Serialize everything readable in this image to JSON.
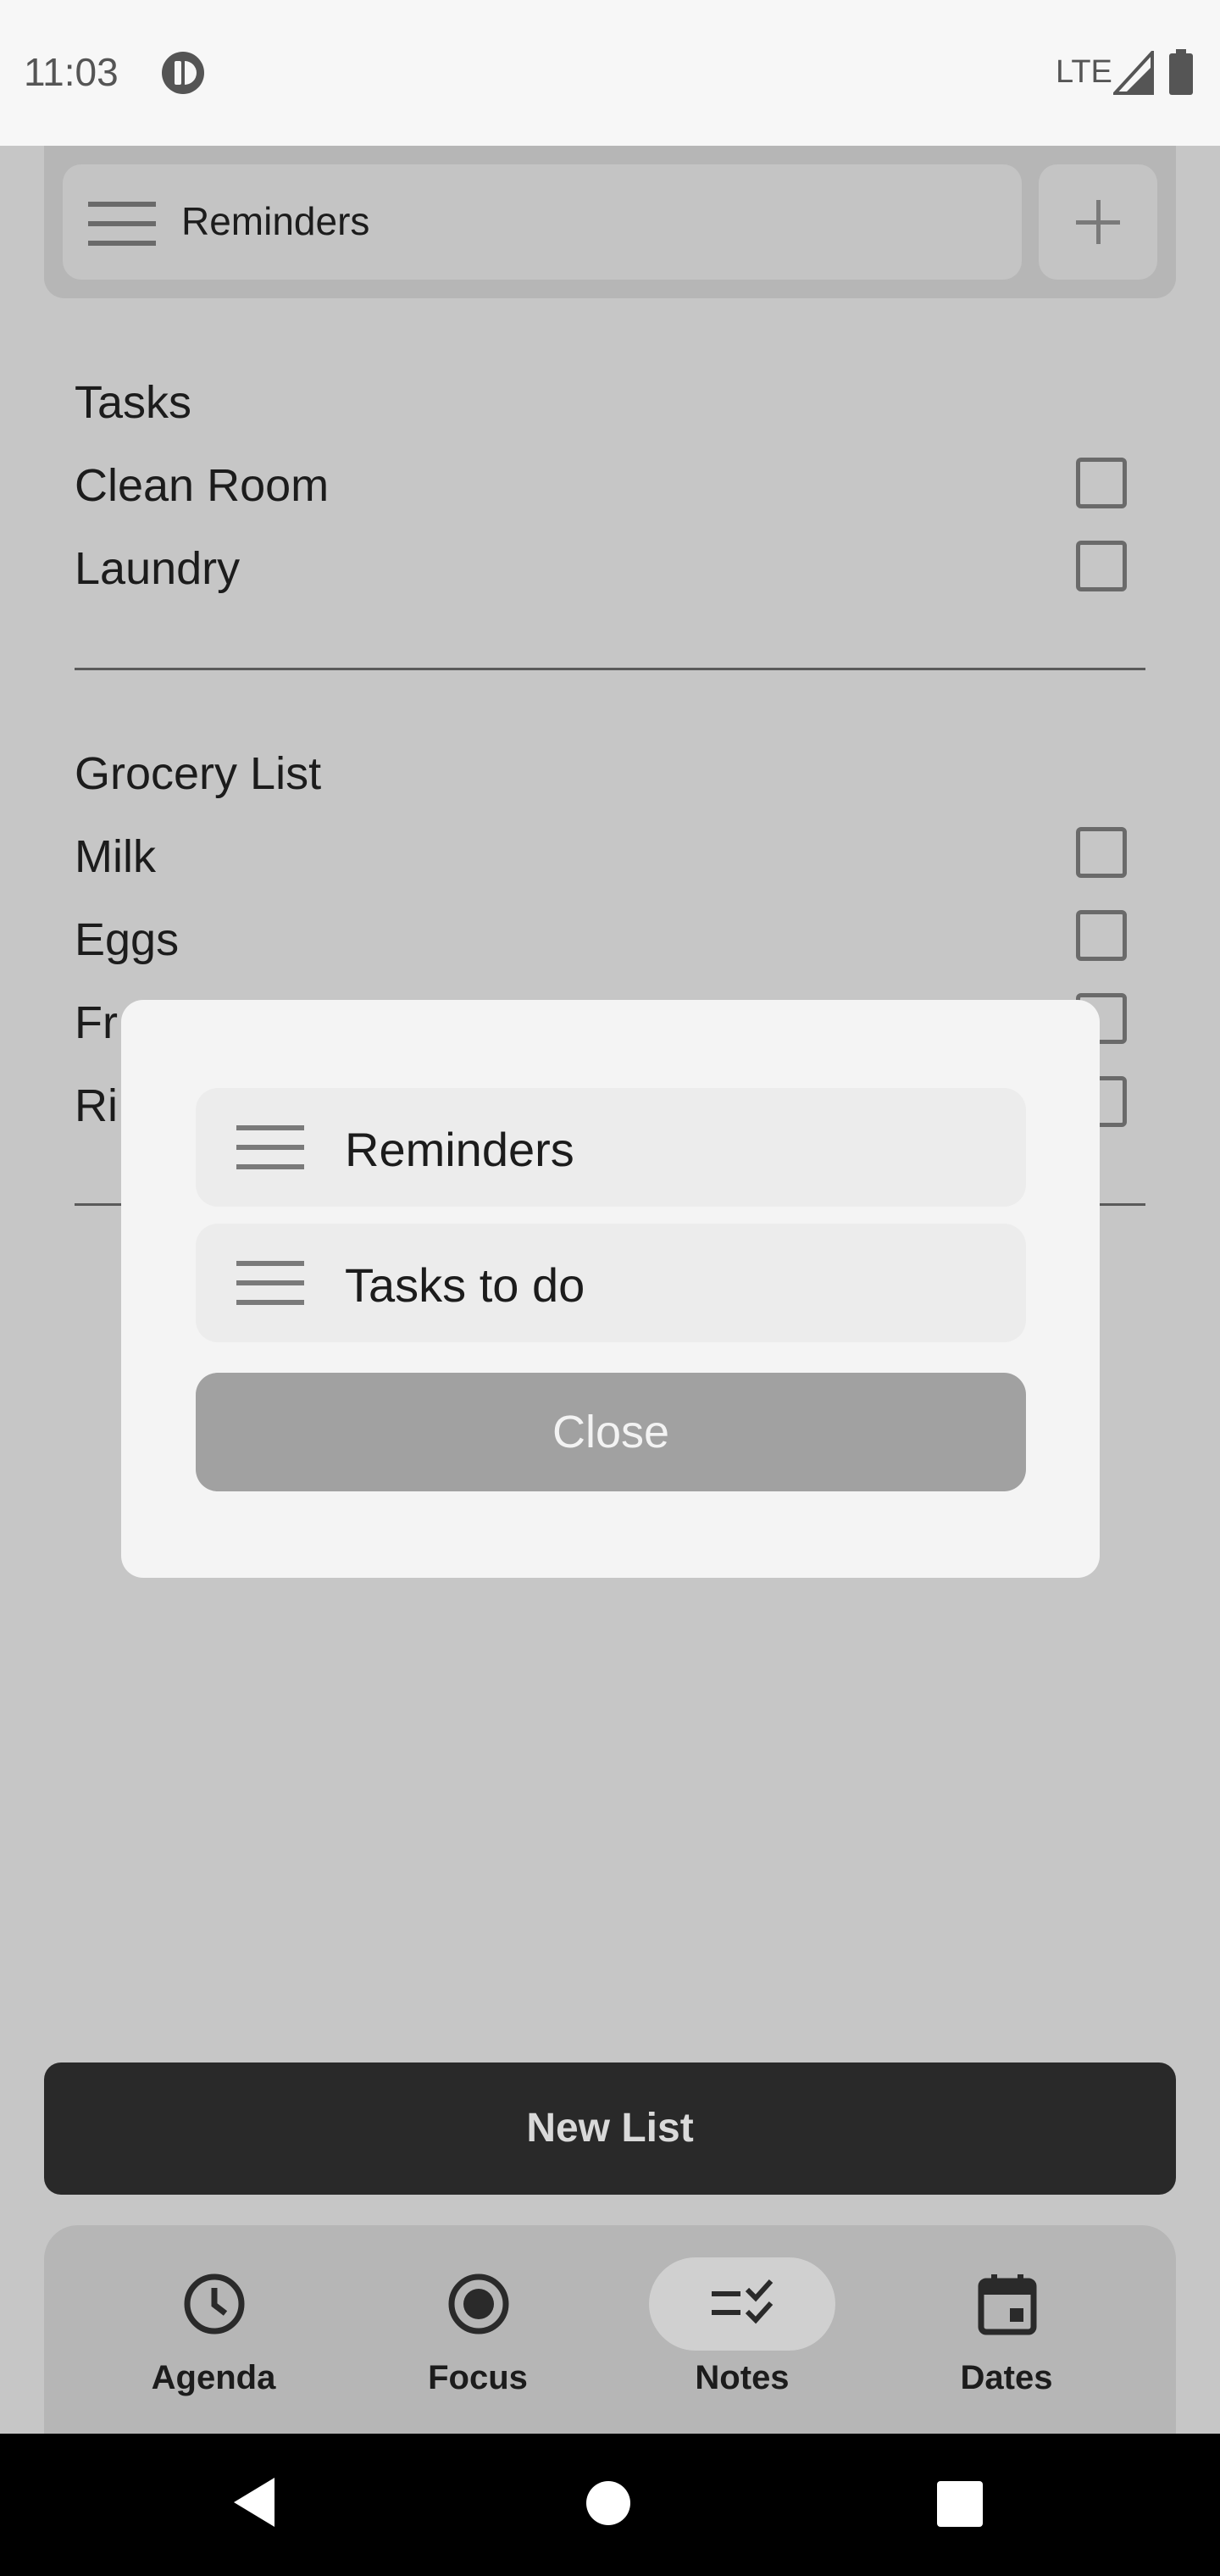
{
  "status_bar": {
    "time": "11:03",
    "network": "LTE"
  },
  "top_bar": {
    "selected_list": "Reminders",
    "add_icon": "plus-icon"
  },
  "lists": [
    {
      "title": "Tasks",
      "items": [
        {
          "label": "Clean Room",
          "checked": false
        },
        {
          "label": "Laundry",
          "checked": false
        }
      ]
    },
    {
      "title": "Grocery List",
      "items": [
        {
          "label": "Milk",
          "checked": false
        },
        {
          "label": "Eggs",
          "checked": false
        },
        {
          "label": "Fr",
          "checked": false
        },
        {
          "label": "Ri",
          "checked": false
        }
      ]
    }
  ],
  "dialog": {
    "items": [
      {
        "label": "Reminders",
        "icon": "menu-icon"
      },
      {
        "label": "Tasks to do",
        "icon": "menu-icon"
      }
    ],
    "close_label": "Close"
  },
  "new_list_label": "New List",
  "bottom_nav": [
    {
      "label": "Agenda",
      "icon": "clock-icon",
      "active": false
    },
    {
      "label": "Focus",
      "icon": "radio-target-icon",
      "active": false
    },
    {
      "label": "Notes",
      "icon": "checklist-icon",
      "active": true
    },
    {
      "label": "Dates",
      "icon": "calendar-icon",
      "active": false
    }
  ],
  "colors": {
    "overlay_bg": "#c6c6c6",
    "dialog_bg": "#f4f4f4",
    "primary_button": "#292929",
    "active_pill": "#d0d0d0"
  }
}
